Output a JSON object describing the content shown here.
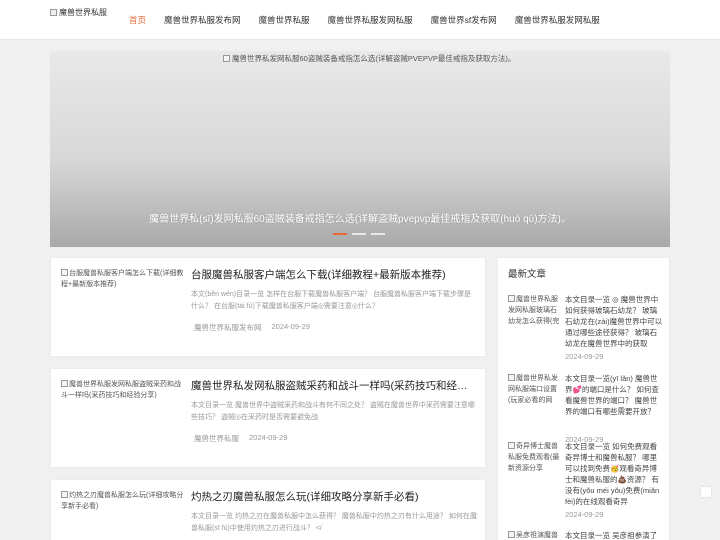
{
  "header": {
    "logo_alt": "魔兽世界私服",
    "nav": [
      {
        "label": "首页",
        "active": true
      },
      {
        "label": "魔兽世界私服发布网",
        "active": false
      },
      {
        "label": "魔兽世界私服",
        "active": false
      },
      {
        "label": "魔兽世界私服发网私服",
        "active": false
      },
      {
        "label": "魔兽世界sf发布网",
        "active": false
      },
      {
        "label": "魔兽世界私服发网私服",
        "active": false
      }
    ]
  },
  "hero": {
    "image_alt": "魔兽世界私发网私服60盗贼装备戒指怎么选(详解盗贼PVEPVP最佳戒指及获取方法)。",
    "caption": "魔兽世界私(sī)发网私服60盗贼装备戒指怎么选(详解盗贼pvepvp最佳戒指及获取(huò qǔ)方法)。",
    "slides": 3,
    "active_slide": 1
  },
  "articles": [
    {
      "thumb_alt": "台服魔兽私服客户端怎么下载(详细教程+最新版本推荐)",
      "title": "台服魔兽私服客户端怎么下载(详细教程+最新版本推荐)",
      "excerpt": "本文(běn wén)目录一览 怎样在台服下载魔兽私服客户端？ 台服魔兽私服客户端下载步骤是什么？ 在台服(tái fú)下载魔兽私服客户端◎需要注意◎什么？",
      "category": "魔兽世界私服发布网",
      "date": "2024-09-29"
    },
    {
      "thumb_alt": "魔兽世界私服发网私服盗贼采药和战斗一样吗(采药技巧和经验分享)",
      "title": "魔兽世界私发网私服盗贼采药和战斗一样吗(采药技巧和经验分享)",
      "excerpt": "本文目录一览 魔兽世界中盗贼采药和战斗有何不同之处？ 盗贼在魔兽世界中采药需要注意哪些技巧？ 盗贼◎在采药时是否需要避免战",
      "category": "魔兽世界私服",
      "date": "2024-09-29"
    },
    {
      "thumb_alt": "灼热之刃魔兽私服怎么玩(详细攻略分享新手必看)",
      "title": "灼热之刃魔兽私服怎么玩(详细攻略分享新手必看)",
      "excerpt": "本文目录一览 灼热之刃在魔兽私服中怎么获得？ 魔兽私服中灼热之刃有什么用途？ 如何在魔兽私服(sī fú)中使用灼热之刃进行战斗？ </",
      "category": "",
      "date": ""
    }
  ],
  "sidebar": {
    "title": "最新文章",
    "items": [
      {
        "thumb_alt": "魔兽世界私服发网私服玻璃石幼龙怎么获得(完",
        "text": "本文目录一览 ◎ 魔兽世界中如何获得玻璃石幼龙？ 玻璃石幼龙在(zài)魔兽世界中可以通过哪些途径获得？ 玻璃石幼龙在魔兽世界中的获取",
        "date": "2024-09-29"
      },
      {
        "thumb_alt": "魔兽世界私发网私服端口设置(玩家必看的网",
        "text": "本文目录一览(yī lǎn) 魔兽世界💕的端口是什么？ 如何查看魔兽世界的端口？ 魔兽世界的端口有哪些需要开放？",
        "date": "2024-09-29"
      },
      {
        "thumb_alt": "奇异博士魔兽私服免费观看(最新资源分享",
        "text": "本文目录一览 如何免费观看奇异博士和魔兽私服？ 哪里可以找到免费🥳观看奇异博士和魔兽私服的💩资源？ 有没有(yǒu méi yǒu)免费(miǎn fèi)的在线观看奇异",
        "date": "2024-09-29"
      },
      {
        "thumb_alt": "吴彦祖演魔兽",
        "text": "本文目录一览 吴彦祖参演了魔",
        "date": ""
      }
    ]
  }
}
